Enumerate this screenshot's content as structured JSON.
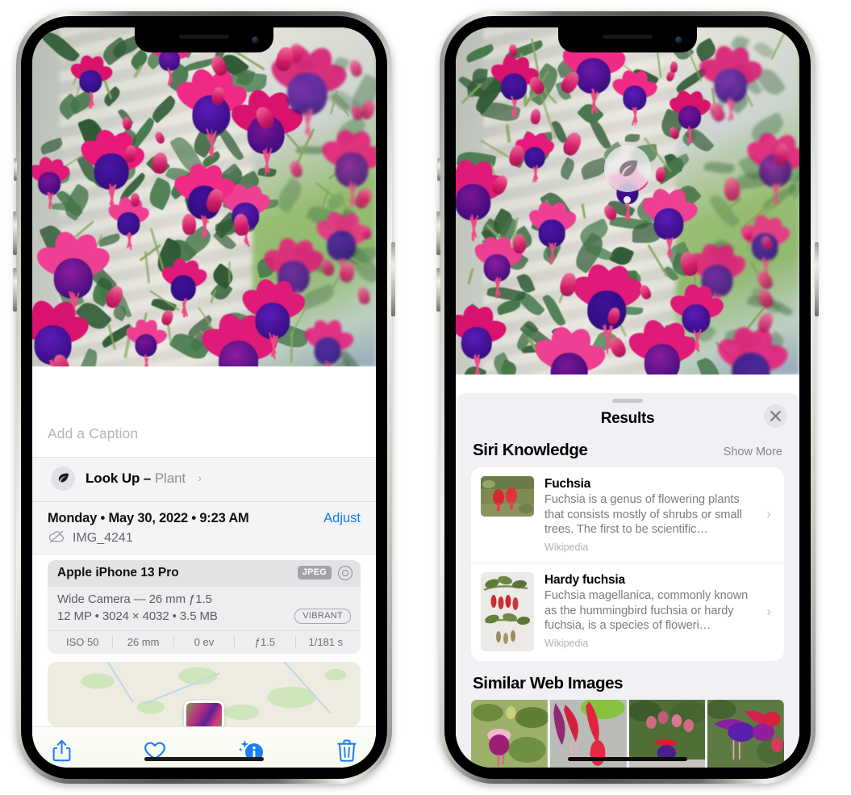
{
  "left_phone": {
    "caption_field": {
      "placeholder": "Add a Caption",
      "value": ""
    },
    "lookup_row": {
      "label": "Look Up",
      "dash": "–",
      "subject": "Plant",
      "chevron": "›",
      "icon": "leaf-icon"
    },
    "metadata": {
      "date_line": "Monday • May 30, 2022 • 9:23 AM",
      "adjust_label": "Adjust",
      "filename": "IMG_4241",
      "cloud_icon": "cloud-slash-icon"
    },
    "exif": {
      "device_model": "Apple iPhone 13 Pro",
      "format_badge": "JPEG",
      "lens_icon": "lens-aperture-icon",
      "lens_line": "Wide Camera — 26 mm ƒ1.5",
      "size_line": "12 MP • 3024 × 4032 • 3.5 MB",
      "style_badge": "VIBRANT",
      "stats": [
        "ISO 50",
        "26 mm",
        "0 ev",
        "ƒ1.5",
        "1/181 s"
      ]
    },
    "toolbar": [
      {
        "name": "share-button",
        "icon": "share-icon"
      },
      {
        "name": "favorite-button",
        "icon": "heart-icon"
      },
      {
        "name": "info-button",
        "icon": "info-sparkle-icon"
      },
      {
        "name": "delete-button",
        "icon": "trash-icon"
      }
    ]
  },
  "right_phone": {
    "visual_lookup_marker": {
      "icon": "leaf-icon"
    },
    "sheet": {
      "title": "Results",
      "close_icon": "close-icon",
      "siri_section": {
        "title": "Siri Knowledge",
        "action": "Show More"
      },
      "knowledge_items": [
        {
          "title": "Fuchsia",
          "description": "Fuchsia is a genus of flowering plants that consists mostly of shrubs or small trees. The first to be scientific…",
          "source": "Wikipedia",
          "chevron": "›"
        },
        {
          "title": "Hardy fuchsia",
          "description": "Fuchsia magellanica, commonly known as the hummingbird fuchsia or hardy fuchsia, is a species of floweri…",
          "source": "Wikipedia",
          "chevron": "›"
        }
      ],
      "similar_section": {
        "title": "Similar Web Images"
      },
      "similar_images": [
        {
          "name": "similar-web-image-1"
        },
        {
          "name": "similar-web-image-2"
        },
        {
          "name": "similar-web-image-3"
        },
        {
          "name": "similar-web-image-4"
        }
      ]
    }
  },
  "colors": {
    "accent_blue": "#1d7df5",
    "sheet_bg": "#f1f1f5",
    "card_bg": "#ffffff",
    "secondary_text": "#8e8e93"
  }
}
